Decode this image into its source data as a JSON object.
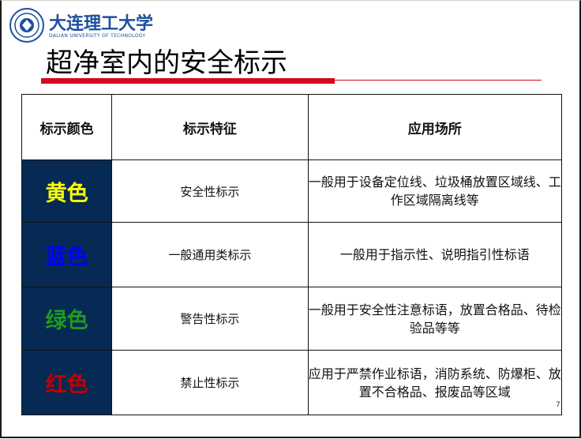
{
  "header": {
    "logo_cn": "大连理工大学",
    "logo_en": "DALIAN UNIVERSITY OF TECHNOLOGY"
  },
  "title": "超净室内的安全标示",
  "table": {
    "headers": [
      "标示颜色",
      "标示特征",
      "应用场所"
    ],
    "rows": [
      {
        "color": "黄色",
        "color_hex": "#ffff00",
        "feature": "安全性标示",
        "usage": "一般用于设备定位线、垃圾桶放置区域线、工作区域隔离线等"
      },
      {
        "color": "蓝色",
        "color_hex": "#0000ff",
        "feature": "一般通用类标示",
        "usage": "一般用于指示性、说明指引性标语"
      },
      {
        "color": "绿色",
        "color_hex": "#1f9a1f",
        "feature": "警告性标示",
        "usage": "一般用于安全性注意标语，放置合格品、待检验品等等"
      },
      {
        "color": "红色",
        "color_hex": "#c00000",
        "feature": "禁止性标示",
        "usage": "应用于严禁作业标语，消防系统、防爆柜、放置不合格品、报废品等区域"
      }
    ]
  },
  "colors": {
    "accent_red": "#d4091d",
    "cell_bg": "#062a54",
    "logo_blue": "#1d4f9e"
  },
  "page_number": "7"
}
